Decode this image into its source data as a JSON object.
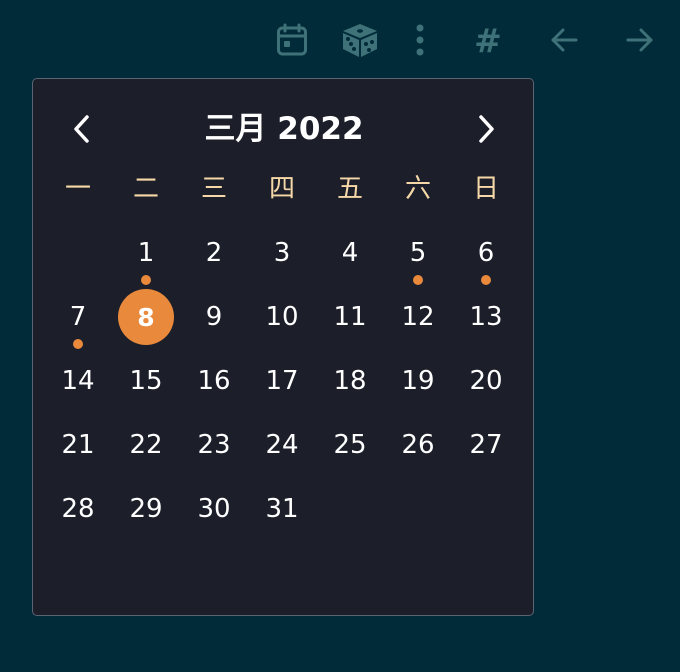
{
  "toolbar": {
    "items": [
      {
        "name": "calendar-icon"
      },
      {
        "name": "dice-icon"
      },
      {
        "name": "more-vertical-icon"
      },
      {
        "name": "hash-icon",
        "label": "#"
      },
      {
        "name": "arrow-left-icon"
      },
      {
        "name": "arrow-right-icon"
      }
    ],
    "icon_color": "#3f7278"
  },
  "calendar": {
    "title": "三月 2022",
    "prev_icon": "chevron-left-icon",
    "next_icon": "chevron-right-icon",
    "weekdays": [
      "一",
      "二",
      "三",
      "四",
      "五",
      "六",
      "日"
    ],
    "weeks": [
      [
        "",
        "1",
        "2",
        "3",
        "4",
        "5",
        "6"
      ],
      [
        "7",
        "8",
        "9",
        "10",
        "11",
        "12",
        "13"
      ],
      [
        "14",
        "15",
        "16",
        "17",
        "18",
        "19",
        "20"
      ],
      [
        "21",
        "22",
        "23",
        "24",
        "25",
        "26",
        "27"
      ],
      [
        "28",
        "29",
        "30",
        "31",
        "",
        "",
        ""
      ]
    ],
    "selected_day": "8",
    "days_with_entries": [
      "1",
      "5",
      "6",
      "7"
    ],
    "colors": {
      "background": "#1c1f2a",
      "border": "#5b6472",
      "weekday_text": "#f6d8a8",
      "day_text": "#ffffff",
      "accent": "#e8893c"
    }
  },
  "page": {
    "background": "#022b3a"
  }
}
